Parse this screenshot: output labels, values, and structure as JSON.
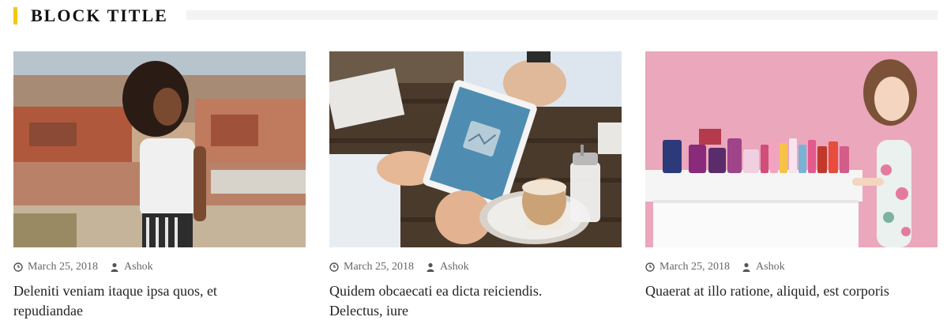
{
  "block": {
    "title": "BLOCK TITLE",
    "accent_color": "#f5c518"
  },
  "posts": [
    {
      "image": "woman-city-rooftops-photo",
      "date": "March 25, 2018",
      "author": "Ashok",
      "title": "Deleniti veniam itaque ipsa quos, et repudiandae"
    },
    {
      "image": "tablet-coffee-table-photo",
      "date": "March 25, 2018",
      "author": "Ashok",
      "title": "Quidem obcaecati ea dicta reiciendis. Delectus, iure"
    },
    {
      "image": "woman-cosmetics-pink-photo",
      "date": "March 25, 2018",
      "author": "Ashok",
      "title": "Quaerat at illo ratione, aliquid, est corporis"
    }
  ]
}
